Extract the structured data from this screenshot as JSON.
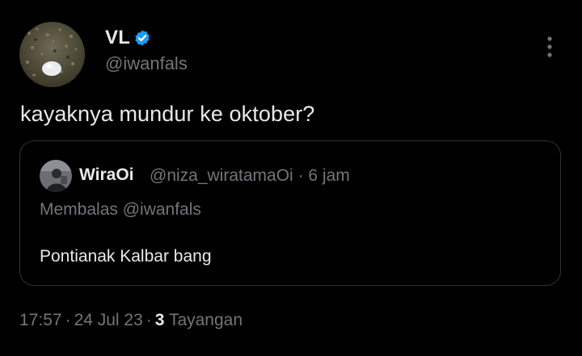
{
  "tweet": {
    "author": {
      "name": "VL",
      "handle": "@iwanfals",
      "verified": true,
      "avatar_icon": "avatar-egg-on-leaves"
    },
    "text": "kayaknya mundur ke oktober?",
    "more_icon": "more-vertical-icon",
    "quoted": {
      "name": "WiraOi",
      "handle": "@niza_wiratamaOi",
      "time": "6 jam",
      "reply_prefix": "Membalas",
      "reply_to": "@iwanfals",
      "text": "Pontianak Kalbar bang"
    },
    "footer": {
      "time": "17:57",
      "date": "24 Jul 23",
      "views_count": "3",
      "views_label": "Tayangan"
    }
  },
  "colors": {
    "background": "#000000",
    "primary_text": "#e7e9ea",
    "secondary_text": "#71767b",
    "verified_blue": "#1d9bf0",
    "border": "#2f3336"
  }
}
